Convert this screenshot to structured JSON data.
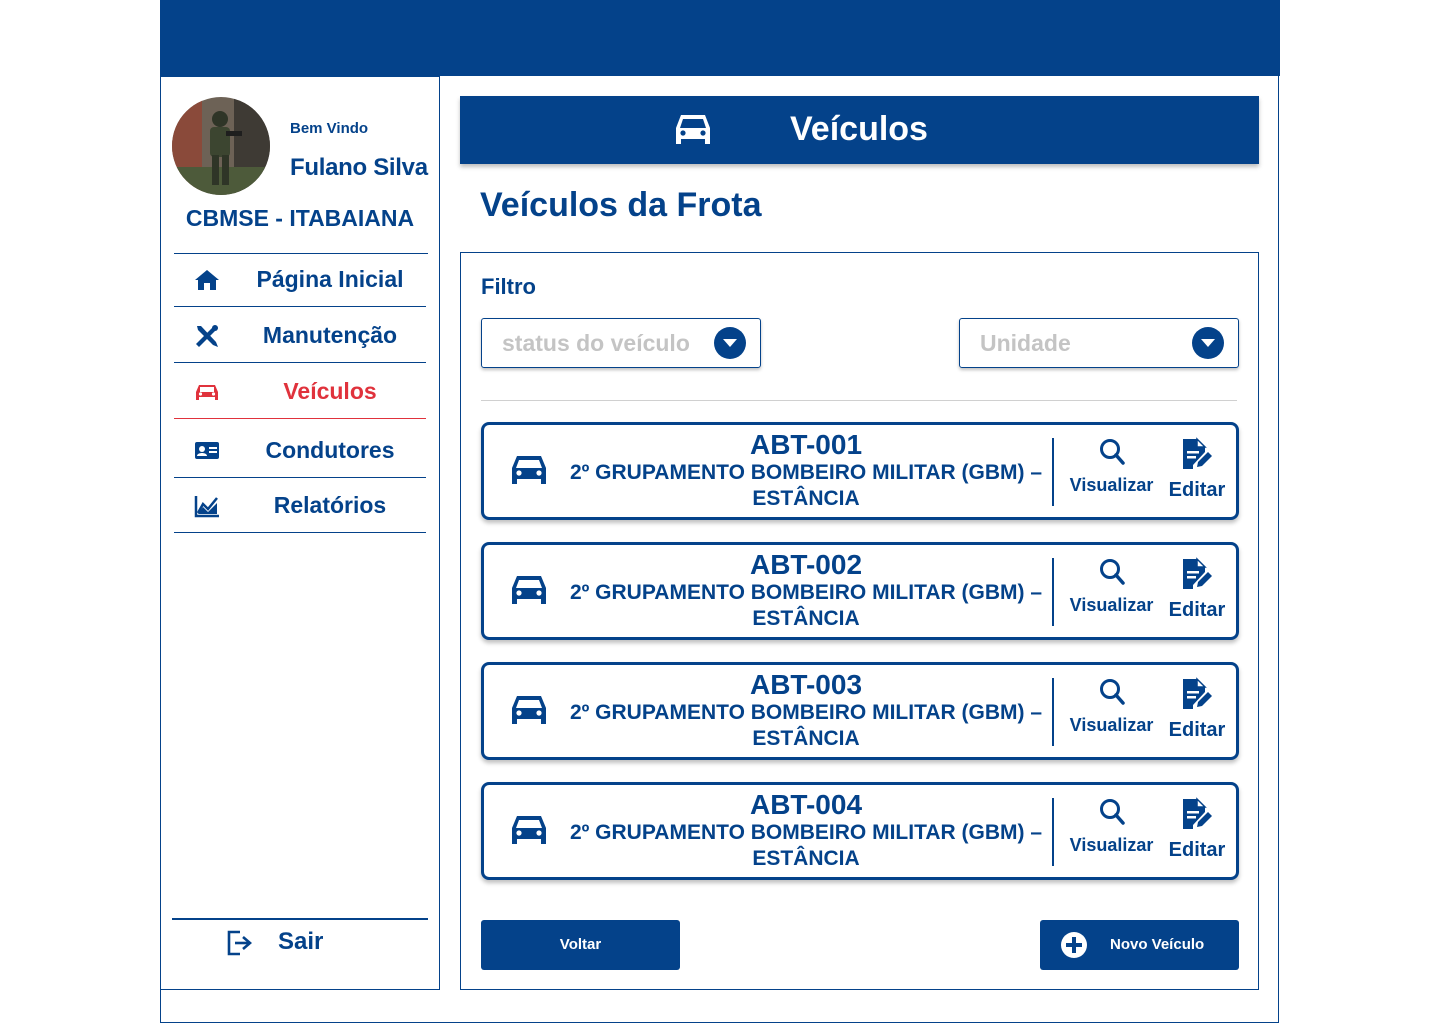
{
  "sidebar": {
    "welcome": "Bem Vindo",
    "user_name": "Fulano Silva",
    "unit": "CBMSE - ITABAIANA",
    "nav": [
      {
        "label": "Página Inicial",
        "icon": "home-icon"
      },
      {
        "label": "Manutenção",
        "icon": "tools-icon"
      },
      {
        "label": "Veículos",
        "icon": "car-icon",
        "active": true
      },
      {
        "label": "Condutores",
        "icon": "id-card-icon"
      },
      {
        "label": "Relatórios",
        "icon": "chart-icon"
      }
    ],
    "logout": "Sair"
  },
  "header": {
    "title": "Veículos"
  },
  "main": {
    "subtitle": "Veículos da Frota",
    "filter_label": "Filtro",
    "status_placeholder": "status do veículo",
    "unit_placeholder": "Unidade",
    "vehicles": [
      {
        "plate": "ABT-001",
        "unit_line1": "2º GRUPAMENTO BOMBEIRO MILITAR (GBM) –",
        "unit_line2": "ESTÂNCIA"
      },
      {
        "plate": "ABT-002",
        "unit_line1": "2º GRUPAMENTO BOMBEIRO MILITAR (GBM) –",
        "unit_line2": "ESTÂNCIA"
      },
      {
        "plate": "ABT-003",
        "unit_line1": "2º GRUPAMENTO BOMBEIRO MILITAR (GBM) –",
        "unit_line2": "ESTÂNCIA"
      },
      {
        "plate": "ABT-004",
        "unit_line1": "2º GRUPAMENTO BOMBEIRO MILITAR (GBM) –",
        "unit_line2": "ESTÂNCIA"
      }
    ],
    "view_label": "Visualizar",
    "edit_label": "Editar",
    "back_button": "Voltar",
    "new_button": "Novo Veículo"
  },
  "colors": {
    "primary": "#04428a",
    "active": "#e0323c",
    "placeholder": "#c4c4c4"
  }
}
